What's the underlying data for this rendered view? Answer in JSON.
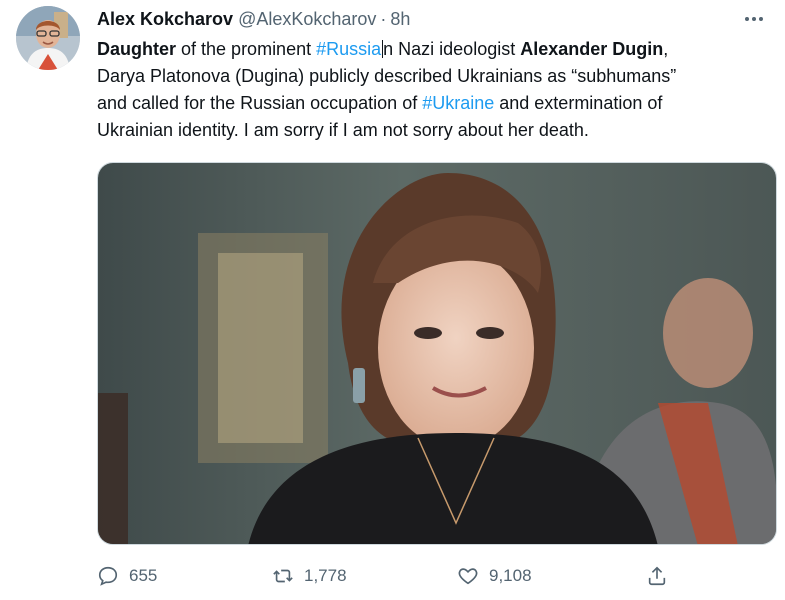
{
  "tweet": {
    "author_name": "Alex Kokcharov",
    "author_handle": "@AlexKokcharov",
    "separator": "·",
    "time": "8h",
    "text": {
      "l1_a": "Daughter",
      "l1_b": " of the prominent ",
      "l1_tag": "#Russia",
      "l1_c": "n Nazi ideologist ",
      "l1_d": "Alexander Dugin",
      "l1_e": ",",
      "l2": "Darya Platonova (Dugina) publicly described Ukrainians as “subhumans”",
      "l3_a": "and called for the Russian occupation of ",
      "l3_tag": "#Ukraine",
      "l3_b": " and extermination of",
      "l4": "Ukrainian identity. I am sorry if I am not sorry about her death."
    },
    "actions": {
      "replies": "655",
      "retweets": "1,778",
      "likes": "9,108"
    }
  },
  "icons": {
    "more": "more-dots-icon",
    "reply": "reply-bubble-icon",
    "retweet": "retweet-arrows-icon",
    "like": "heart-icon",
    "share": "share-upload-icon"
  },
  "colors": {
    "text": "#0f1419",
    "secondary": "#536471",
    "link": "#1d9bf0",
    "border": "#cfd9de"
  }
}
